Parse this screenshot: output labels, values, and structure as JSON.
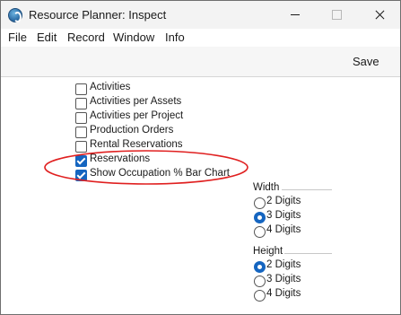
{
  "window": {
    "title": "Resource Planner: Inspect"
  },
  "menu": [
    {
      "label": "File"
    },
    {
      "label": "Edit"
    },
    {
      "label": "Record"
    },
    {
      "label": "Window"
    },
    {
      "label": "Info"
    }
  ],
  "toolbar": {
    "save_label": "Save"
  },
  "checkboxes": [
    {
      "label": "Activities",
      "checked": false
    },
    {
      "label": "Activities per Assets",
      "checked": false
    },
    {
      "label": "Activities per Project",
      "checked": false
    },
    {
      "label": "Production Orders",
      "checked": false
    },
    {
      "label": "Rental Reservations",
      "checked": false
    },
    {
      "label": "Reservations",
      "checked": true
    },
    {
      "label": "Show Occupation % Bar Chart",
      "checked": true
    }
  ],
  "width_group": {
    "title": "Width",
    "options": [
      {
        "label": "2 Digits",
        "selected": false
      },
      {
        "label": "3 Digits",
        "selected": true
      },
      {
        "label": "4 Digits",
        "selected": false
      }
    ]
  },
  "height_group": {
    "title": "Height",
    "options": [
      {
        "label": "2 Digits",
        "selected": true
      },
      {
        "label": "3 Digits",
        "selected": false
      },
      {
        "label": "4 Digits",
        "selected": false
      }
    ]
  },
  "colors": {
    "accent": "#1565c0",
    "annotation_ellipse": "#e02020"
  }
}
